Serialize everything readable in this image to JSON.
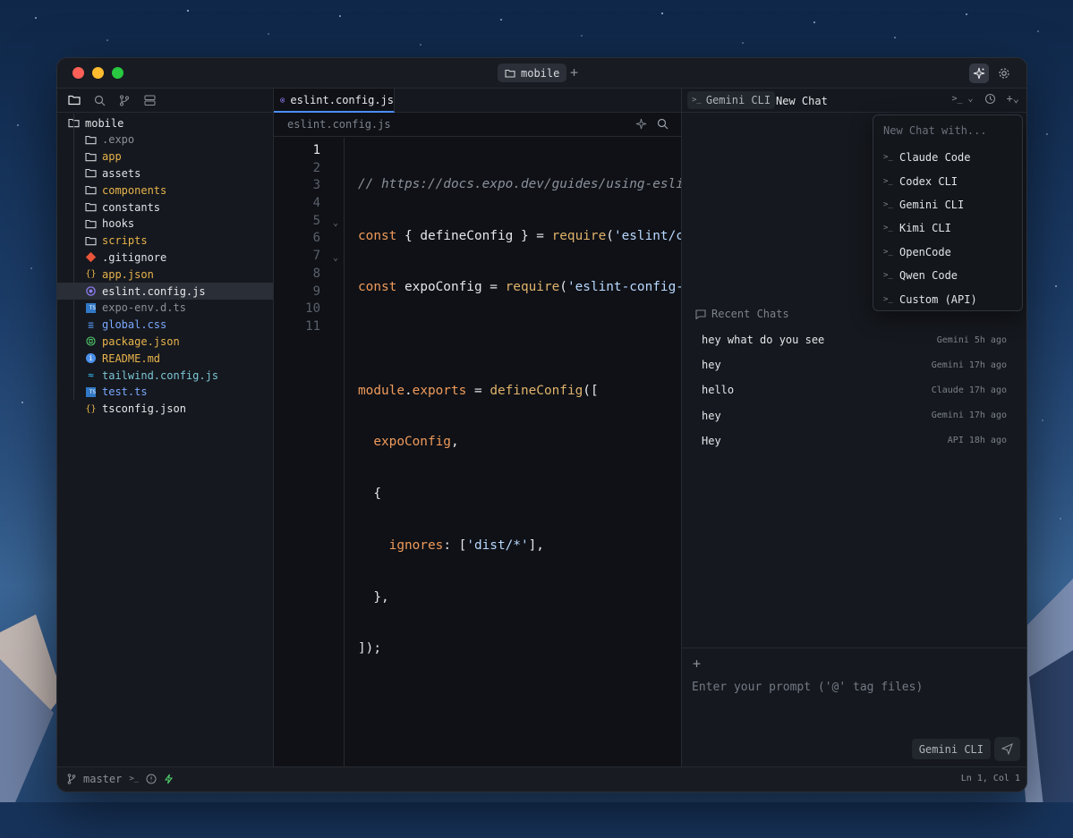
{
  "titlebar": {
    "workspace_tab": "mobile",
    "new_tab_symbol": "+"
  },
  "sidebar": {
    "root": "mobile",
    "items": [
      {
        "name": ".expo",
        "type": "folder",
        "color": "#8b9099"
      },
      {
        "name": "app",
        "type": "folder",
        "color": "#e8b44c"
      },
      {
        "name": "assets",
        "type": "folder",
        "color": "#dfe2e6"
      },
      {
        "name": "components",
        "type": "folder",
        "color": "#e8b44c"
      },
      {
        "name": "constants",
        "type": "folder",
        "color": "#dfe2e6"
      },
      {
        "name": "hooks",
        "type": "folder",
        "color": "#dfe2e6"
      },
      {
        "name": "scripts",
        "type": "folder",
        "color": "#e8b44c"
      },
      {
        "name": ".gitignore",
        "type": "git",
        "color": "#dfe2e6"
      },
      {
        "name": "app.json",
        "type": "json",
        "color": "#e8b44c"
      },
      {
        "name": "eslint.config.js",
        "type": "eslint",
        "color": "#e6e8eb"
      },
      {
        "name": "expo-env.d.ts",
        "type": "ts",
        "color": "#8b9099"
      },
      {
        "name": "global.css",
        "type": "css",
        "color": "#7aa8ff"
      },
      {
        "name": "package.json",
        "type": "npm",
        "color": "#e8b44c"
      },
      {
        "name": "README.md",
        "type": "info",
        "color": "#e8b44c"
      },
      {
        "name": "tailwind.config.js",
        "type": "tailwind",
        "color": "#7cc6d6"
      },
      {
        "name": "test.ts",
        "type": "ts",
        "color": "#7aa8ff"
      },
      {
        "name": "tsconfig.json",
        "type": "json",
        "color": "#e6e8eb"
      }
    ]
  },
  "editor": {
    "tab": "eslint.config.js",
    "breadcrumb": "eslint.config.js",
    "line_numbers": [
      "1",
      "2",
      "3",
      "4",
      "5",
      "6",
      "7",
      "8",
      "9",
      "10",
      "11"
    ]
  },
  "chat": {
    "tab_cli": "Gemini CLI",
    "tab_new": "New Chat",
    "dropdown": {
      "header": "New Chat with...",
      "items": [
        "Claude Code",
        "Codex CLI",
        "Gemini CLI",
        "Kimi CLI",
        "OpenCode",
        "Qwen Code",
        "Custom (API)"
      ]
    },
    "recent_title": "Recent Chats",
    "recent": [
      {
        "title": "hey what do you see",
        "provider": "Gemini",
        "age": "5h ago"
      },
      {
        "title": "hey",
        "provider": "Gemini",
        "age": "17h ago"
      },
      {
        "title": "hello",
        "provider": "Claude",
        "age": "17h ago"
      },
      {
        "title": "hey",
        "provider": "Gemini",
        "age": "17h ago"
      },
      {
        "title": "Hey",
        "provider": "API",
        "age": "18h ago"
      }
    ],
    "composer": {
      "placeholder": "Enter your prompt ('@' tag files)",
      "model": "Gemini CLI"
    }
  },
  "statusbar": {
    "branch": "master",
    "cursor": "Ln 1, Col 1"
  }
}
